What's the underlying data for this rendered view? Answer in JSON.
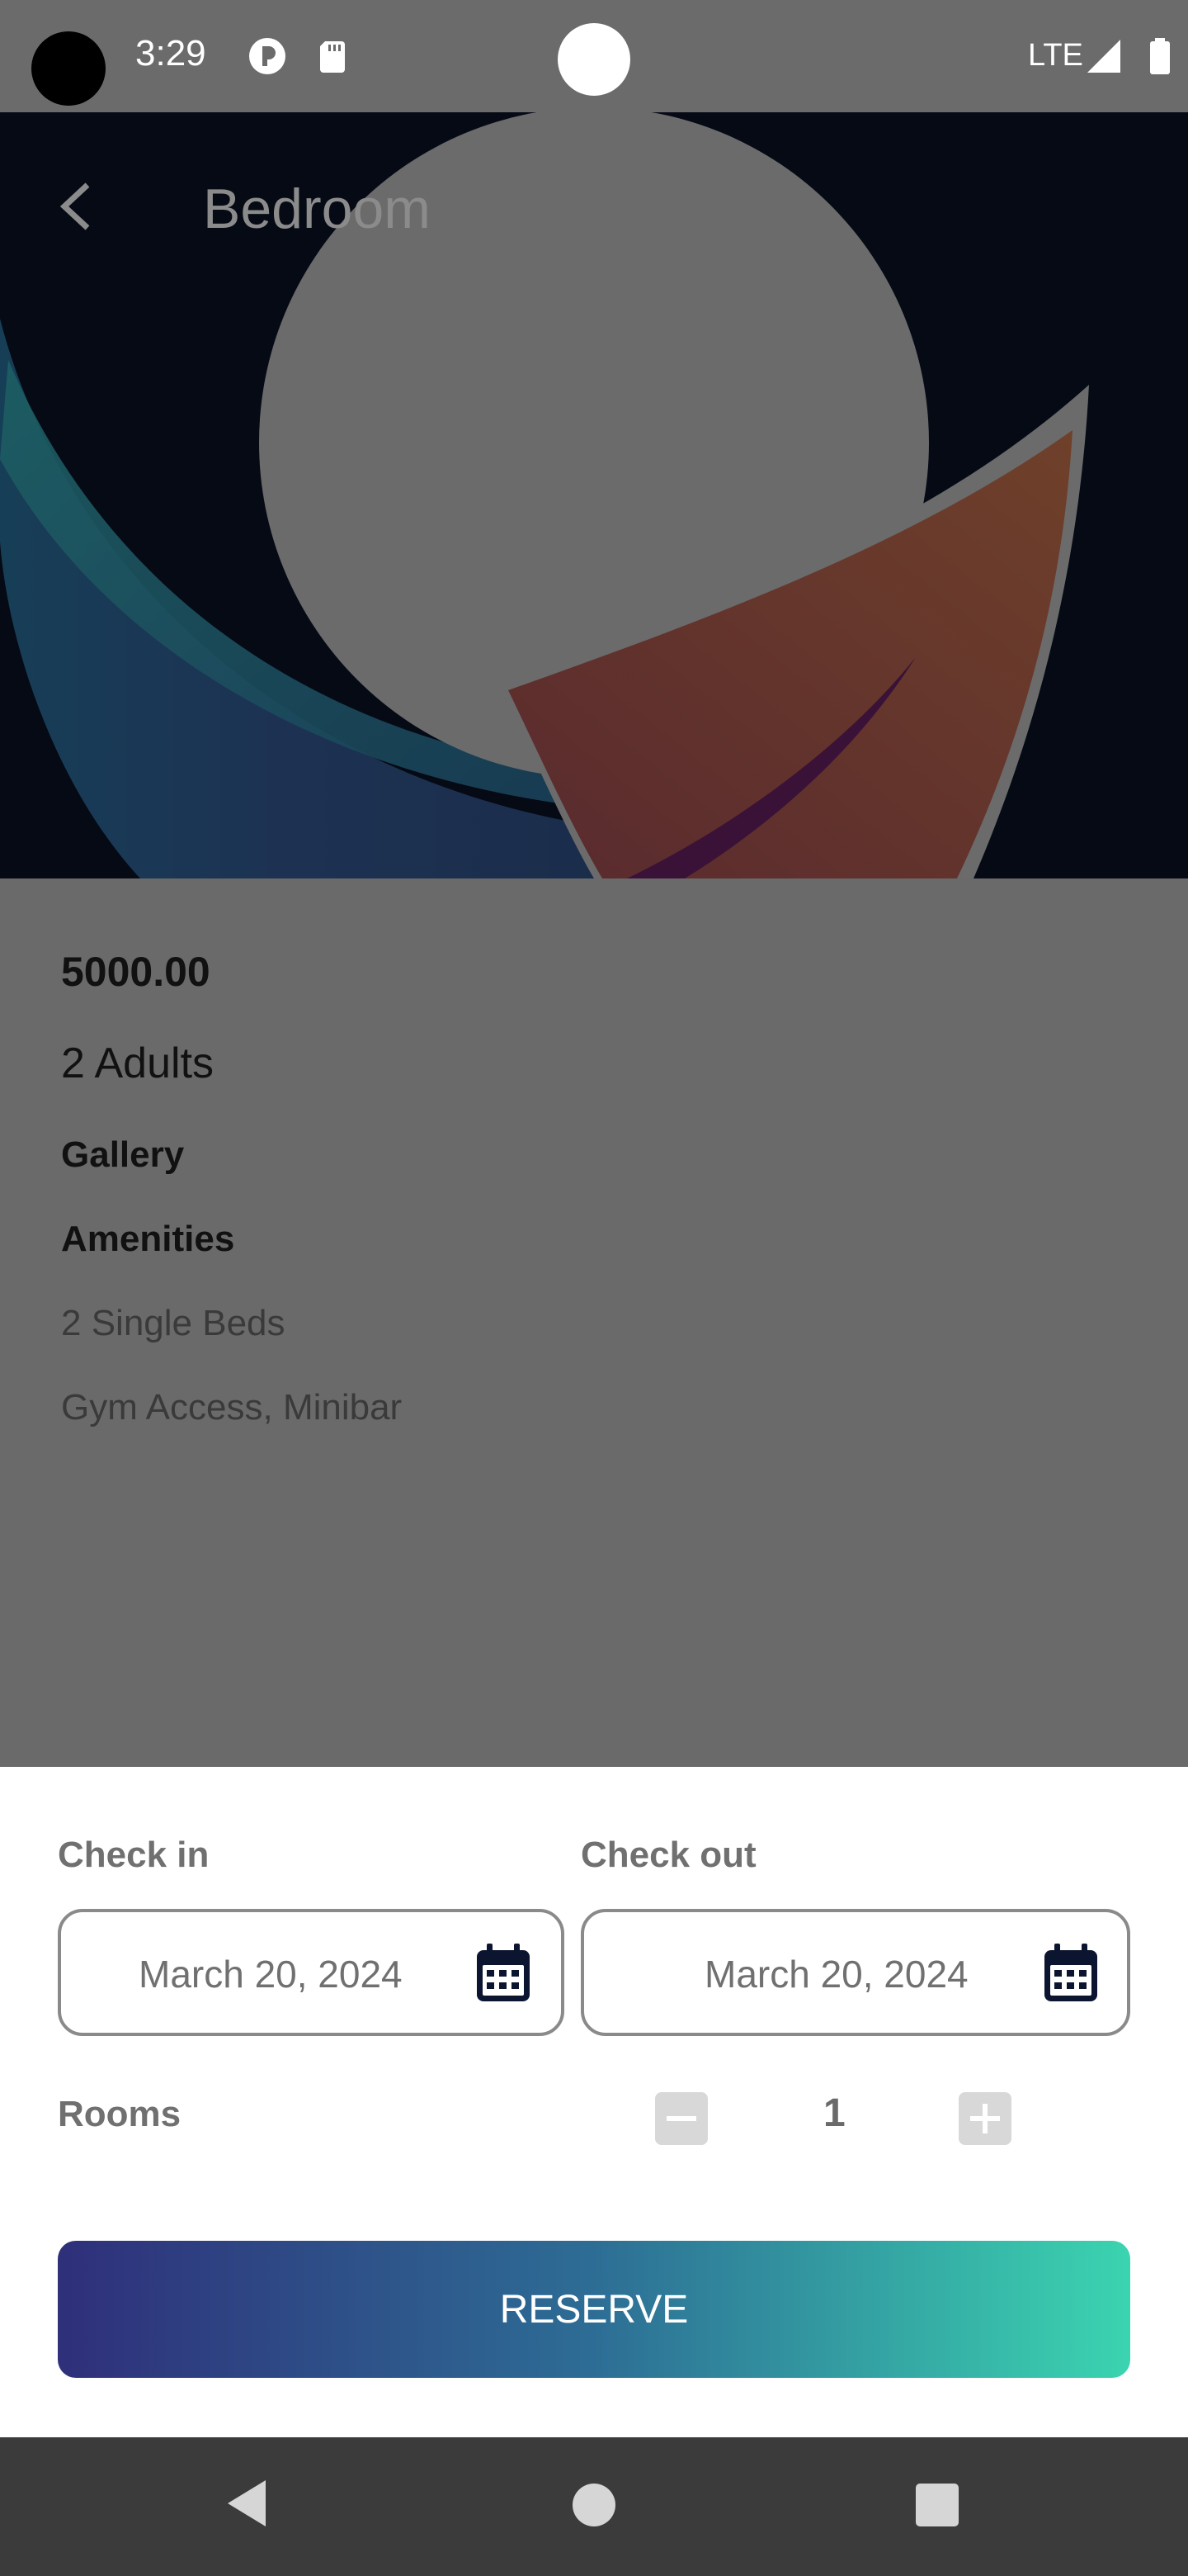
{
  "status_bar": {
    "time": "3:29",
    "network": "LTE",
    "icons": [
      "camera-cutout",
      "app-notification-icon",
      "sd-card-icon",
      "signal-icon",
      "battery-icon"
    ]
  },
  "header": {
    "title": "Bedroom",
    "back_icon": "back-arrow-icon"
  },
  "room": {
    "price": "5000.00",
    "capacity": "2 Adults",
    "gallery_heading": "Gallery",
    "amenities_heading": "Amenities",
    "beds": "2 Single Beds",
    "amenities": "Gym Access, Minibar"
  },
  "booking": {
    "check_in_label": "Check in",
    "check_in_value": "March 20, 2024",
    "check_out_label": "Check out",
    "check_out_value": "March 20, 2024",
    "rooms_label": "Rooms",
    "rooms_value": "1",
    "reserve_label": "RESERVE"
  },
  "colors": {
    "reserve_gradient_start": "#2f2f7a",
    "reserve_gradient_end": "#3bd4b0",
    "overlay": "#6a6a6a"
  }
}
